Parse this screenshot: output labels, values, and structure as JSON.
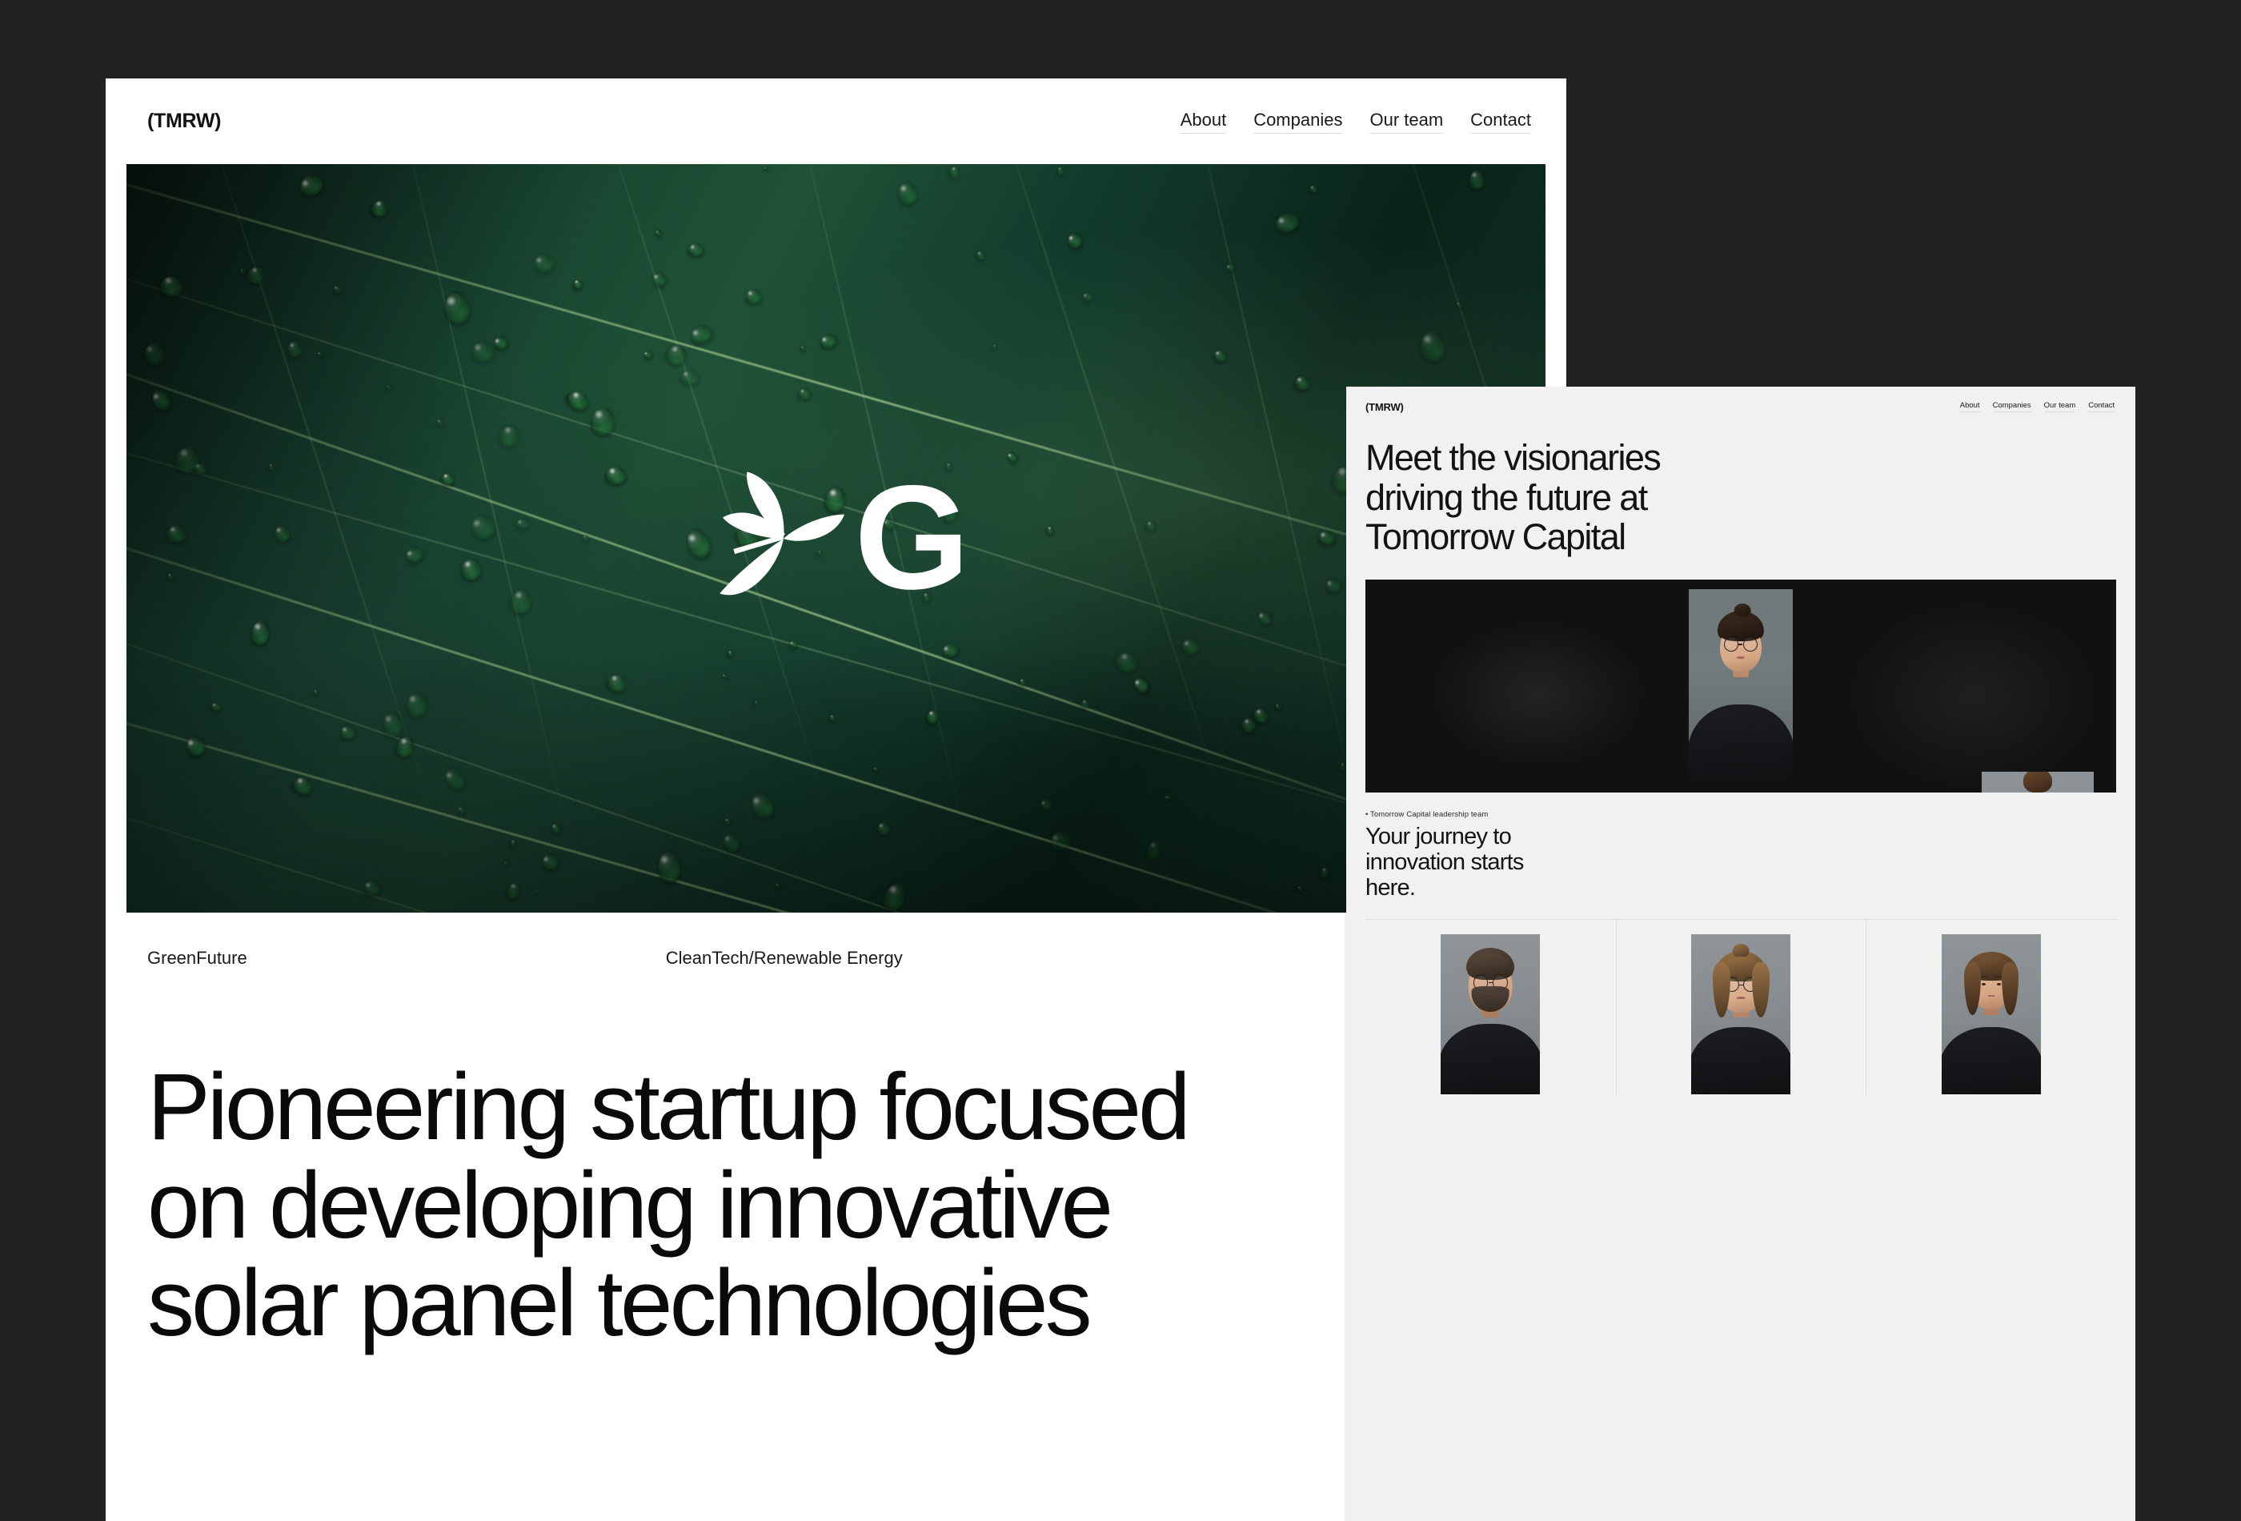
{
  "page": {
    "background_color": "#232223"
  },
  "window1": {
    "background_color": "#ffffff",
    "brand": "(TMRW)",
    "nav": [
      {
        "label": "About"
      },
      {
        "label": "Companies"
      },
      {
        "label": "Our team"
      },
      {
        "label": "Contact"
      }
    ],
    "hero": {
      "image_alt": "close-up of a dark green leaf covered in water droplets",
      "logo_letter": "G",
      "logo_icon": "leaf-sprout-icon",
      "logo_color": "#ffffff"
    },
    "meta": {
      "company": "GreenFuture",
      "category": "CleanTech/Renewable Energy"
    },
    "headline": "Pioneering startup focused on developing innovative solar panel technologies"
  },
  "window2": {
    "background_color": "#f1f1f1",
    "brand": "(TMRW)",
    "nav": [
      {
        "label": "About"
      },
      {
        "label": "Companies"
      },
      {
        "label": "Our team"
      },
      {
        "label": "Contact"
      }
    ],
    "title": "Meet the visionaries\ndriving the future at\nTomorrow  Capital",
    "hero": {
      "background_color": "#111111",
      "portrait_alt": "woman with glasses and black turtleneck on grey backdrop"
    },
    "caption": "• Tomorrow Capital leadership team",
    "subheading": "Your journey to\ninnovation starts\nhere.",
    "team": [
      {
        "photo_alt": "bearded man with glasses in black turtleneck"
      },
      {
        "photo_alt": "woman with hair bun and glasses in black turtleneck"
      },
      {
        "photo_alt": "woman with long wavy hair in black turtleneck"
      }
    ]
  }
}
